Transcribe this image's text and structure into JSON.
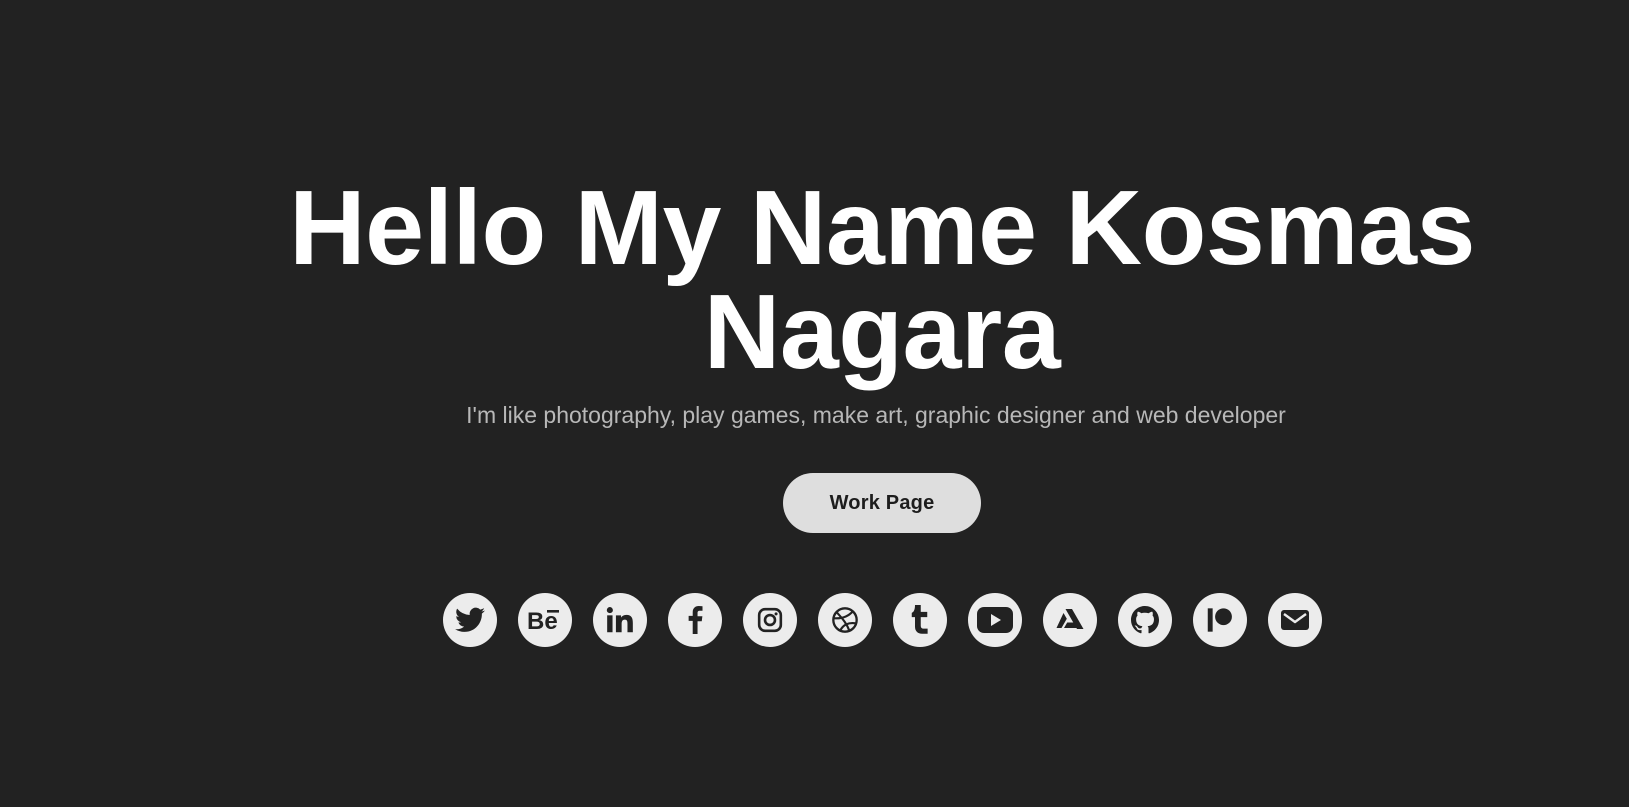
{
  "hero": {
    "title_line1": "Hello My Name Kosmas",
    "title_line2": "Nagara",
    "subtitle": "I'm like photography, play games, make art, graphic designer and web developer",
    "cta_label": "Work Page"
  },
  "social_icons": [
    "twitter-icon",
    "behance-icon",
    "linkedin-icon",
    "facebook-icon",
    "instagram-icon",
    "dribbble-icon",
    "tumblr-icon",
    "youtube-icon",
    "artstation-icon",
    "github-icon",
    "patreon-icon",
    "email-icon"
  ],
  "colors": {
    "background": "#222222",
    "title": "#ffffff",
    "subtitle": "#b8b8b8",
    "button_bg": "#dedede",
    "icon_bg": "#ececec",
    "icon_fg": "#222222"
  }
}
